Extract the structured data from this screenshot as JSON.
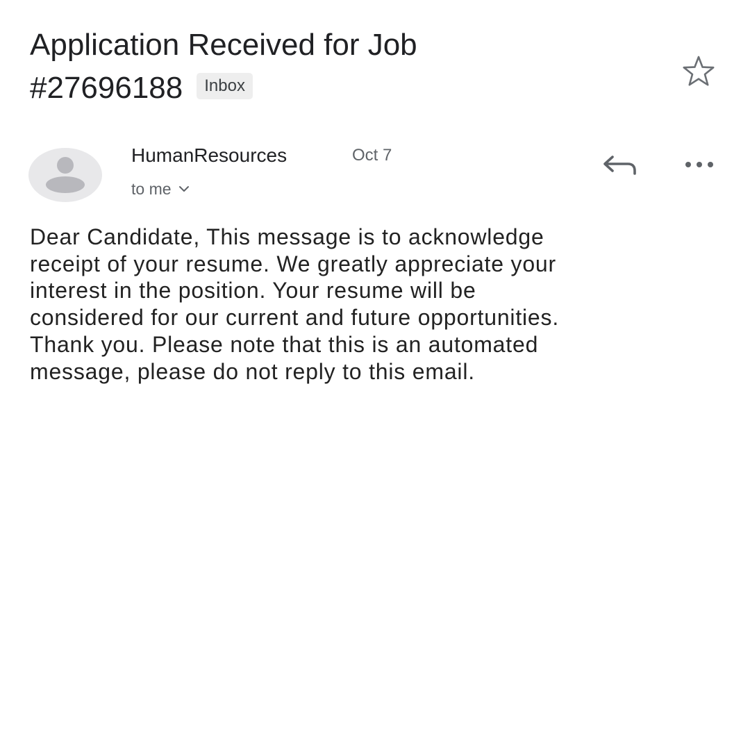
{
  "email": {
    "subject_line_1": "Application Received for Job",
    "subject_line_2": "#27696188",
    "label": "Inbox",
    "sender": "HumanResources",
    "date": "Oct 7",
    "recipient": "to me",
    "body_lines": [
      "Dear Candidate, This message is to acknowledge",
      "receipt of your resume. We greatly appreciate your",
      "interest in the position. Your resume will be",
      "considered for our current and future opportunities.",
      "Thank you. Please note that this is an automated",
      "message, please do not reply to this email."
    ]
  },
  "icons": {
    "star": "star-outline-icon",
    "avatar": "person-icon",
    "recipient_toggle": "chevron-down-icon",
    "reply": "reply-icon",
    "more": "more-horizontal-icon"
  },
  "colors": {
    "label_chip_bg": "#eeeeee",
    "avatar_bg": "#e8e8ea",
    "avatar_figure": "#b8b8bd",
    "icon": "#5f6368"
  }
}
